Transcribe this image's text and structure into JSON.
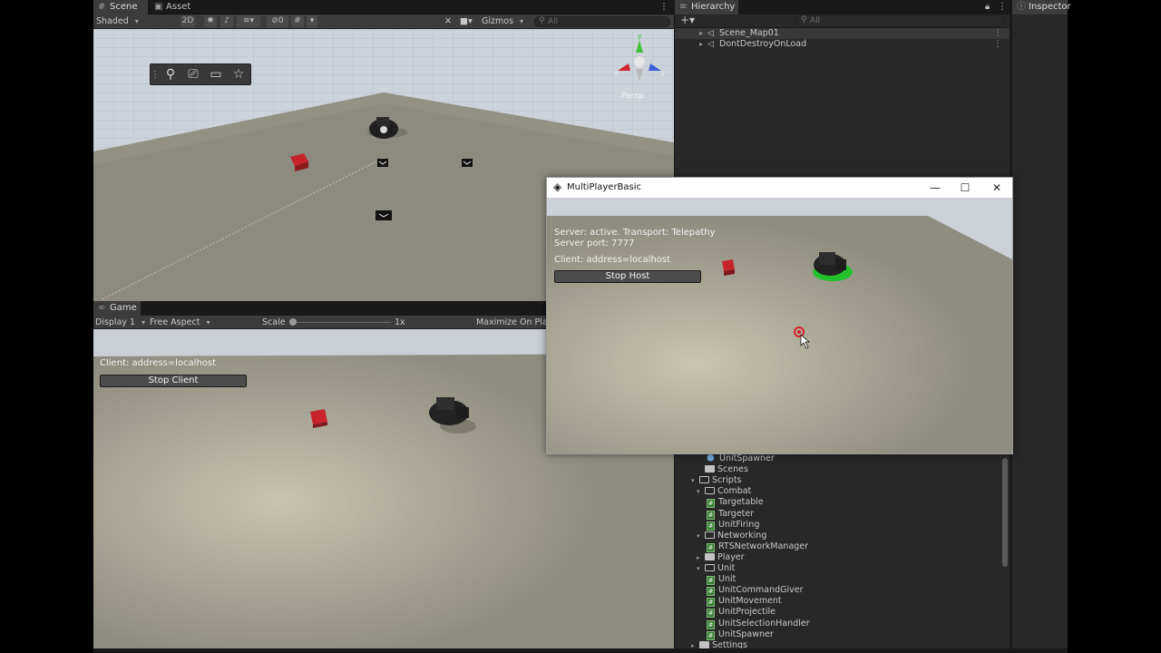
{
  "scene_panel": {
    "tabs": [
      {
        "label": "Scene",
        "icon": "hash-icon"
      },
      {
        "label": "Asset Store",
        "icon": "shopping-bag-icon"
      }
    ],
    "shading_mode": "Shaded",
    "toggle_2d": "2D",
    "hidden_count": "0",
    "gizmos_label": "Gizmos",
    "search_placeholder": "All",
    "projection_label": "Persp",
    "axis_labels": {
      "y": "y",
      "x": "x",
      "z": "z"
    }
  },
  "game_panel": {
    "tab": "Game",
    "display": "Display 1",
    "aspect": "Free Aspect",
    "scale_label": "Scale",
    "scale_value": 0.0,
    "scale_text": "1x",
    "maximize_label": "Maximize On Play",
    "client_status": "Client: address=localhost",
    "stop_button": "Stop Client"
  },
  "hierarchy": {
    "tab": "Hierarchy",
    "search_placeholder": "All",
    "items": [
      {
        "label": "Scene_Map01",
        "selected": true
      },
      {
        "label": "DontDestroyOnLoad",
        "selected": false
      }
    ]
  },
  "project": {
    "items": [
      {
        "label": "UnitSpawner",
        "kind": "prefab",
        "depth": 2,
        "expanded": null
      },
      {
        "label": "Scenes",
        "kind": "folder",
        "depth": 1,
        "expanded": null
      },
      {
        "label": "Scripts",
        "kind": "folder",
        "depth": 0,
        "expanded": true
      },
      {
        "label": "Combat",
        "kind": "folder",
        "depth": 1,
        "expanded": true
      },
      {
        "label": "Targetable",
        "kind": "script",
        "depth": 2,
        "expanded": null
      },
      {
        "label": "Targeter",
        "kind": "script",
        "depth": 2,
        "expanded": null
      },
      {
        "label": "UnitFiring",
        "kind": "script",
        "depth": 2,
        "expanded": null
      },
      {
        "label": "Networking",
        "kind": "folder",
        "depth": 1,
        "expanded": true
      },
      {
        "label": "RTSNetworkManager",
        "kind": "script",
        "depth": 2,
        "expanded": null
      },
      {
        "label": "Player",
        "kind": "folder",
        "depth": 1,
        "expanded": false
      },
      {
        "label": "Unit",
        "kind": "folder",
        "depth": 1,
        "expanded": true
      },
      {
        "label": "Unit",
        "kind": "script",
        "depth": 2,
        "expanded": null
      },
      {
        "label": "UnitCommandGiver",
        "kind": "script",
        "depth": 2,
        "expanded": null
      },
      {
        "label": "UnitMovement",
        "kind": "script",
        "depth": 2,
        "expanded": null
      },
      {
        "label": "UnitProjectile",
        "kind": "script",
        "depth": 2,
        "expanded": null
      },
      {
        "label": "UnitSelectionHandler",
        "kind": "script",
        "depth": 2,
        "expanded": null
      },
      {
        "label": "UnitSpawner",
        "kind": "script",
        "depth": 2,
        "expanded": null
      },
      {
        "label": "Settings",
        "kind": "folder",
        "depth": 0,
        "expanded": false
      }
    ]
  },
  "inspector": {
    "tab": "Inspector"
  },
  "mp_window": {
    "title": "MultiPlayerBasic",
    "server_status": "Server: active. Transport: Telepathy",
    "server_port": "Server port: 7777",
    "client_status": "Client: address=localhost",
    "stop_button": "Stop Host",
    "controls": {
      "minimize": "—",
      "maximize": "☐",
      "close": "✕"
    }
  },
  "colors": {
    "panel_dark": "#191919",
    "panel_mid": "#282828",
    "toolbar": "#3c3c3c",
    "sky": "#cfd5dc",
    "ground": "#8e8b80",
    "red_cube": "#c8232c",
    "selection_green": "#22c02a",
    "click_marker": "#d8202a"
  }
}
